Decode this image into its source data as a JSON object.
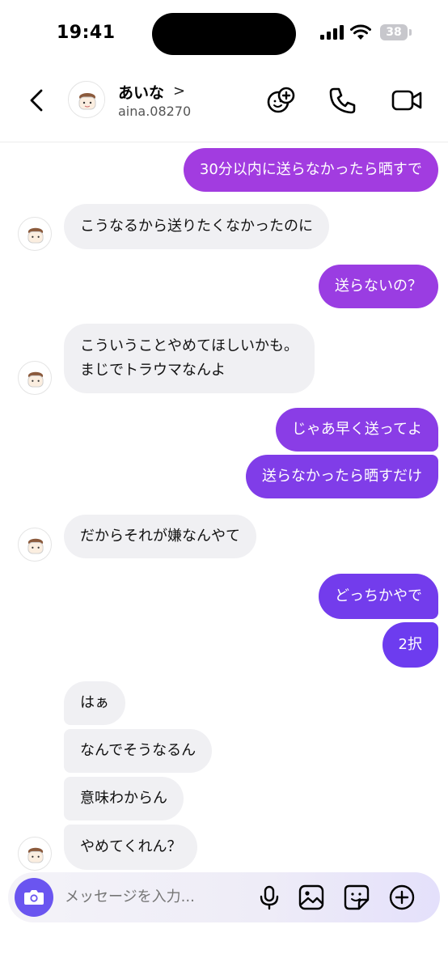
{
  "status_bar": {
    "time": "19:41",
    "battery": "38"
  },
  "header": {
    "contact_name": "あいな",
    "chevron": ">",
    "handle": "aina.08270"
  },
  "messages": [
    {
      "dir": "out",
      "lines": [
        "30分以内に送らなかったら晒すで"
      ]
    },
    {
      "dir": "in",
      "lines": [
        "こうなるから送りたくなかったのに"
      ]
    },
    {
      "dir": "out",
      "lines": [
        "送らないの？"
      ]
    },
    {
      "dir": "in",
      "lines": [
        "こういうことやめてほしいかも。",
        "まじでトラウマなんよ"
      ]
    },
    {
      "dir": "out",
      "lines": [
        "じゃあ早く送ってよ"
      ]
    },
    {
      "dir": "out",
      "lines": [
        "送らなかったら晒すだけ"
      ]
    },
    {
      "dir": "in",
      "lines": [
        "だからそれが嫌なんやて"
      ]
    },
    {
      "dir": "out",
      "lines": [
        "どっちかやで"
      ]
    },
    {
      "dir": "out",
      "lines": [
        "2択"
      ]
    },
    {
      "dir": "in",
      "lines": [
        "はぁ"
      ]
    },
    {
      "dir": "in",
      "lines": [
        "なんでそうなるん"
      ]
    },
    {
      "dir": "in",
      "lines": [
        "意味わからん"
      ]
    },
    {
      "dir": "in",
      "lines": [
        "やめてくれん？"
      ]
    }
  ],
  "composer": {
    "placeholder": "メッセージを入力..."
  },
  "icons": {
    "back": "chevron-left-icon",
    "add_people": "add-people-icon",
    "call": "phone-icon",
    "video": "video-call-icon",
    "camera": "camera-icon",
    "mic": "microphone-icon",
    "gallery": "image-icon",
    "sticker": "sticker-icon",
    "more": "plus-circle-icon"
  },
  "colors": {
    "outgoing_gradient_top": "#a33ee0",
    "outgoing_gradient_bottom": "#6a3cf0",
    "incoming": "#f0f0f3",
    "camera_button": "#6a55f0"
  }
}
